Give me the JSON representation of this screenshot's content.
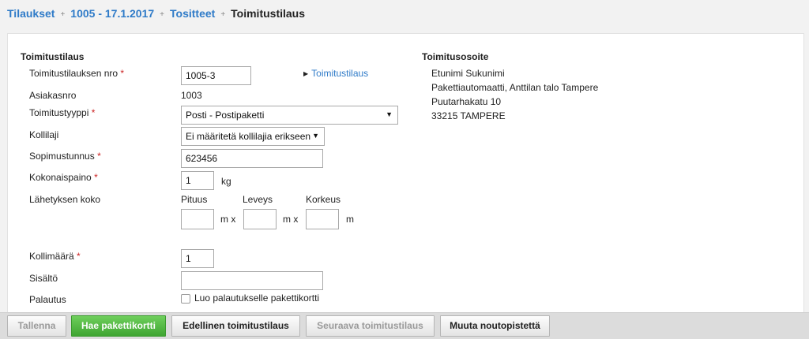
{
  "breadcrumb": {
    "items": [
      "Tilaukset",
      "1005 - 17.1.2017",
      "Tositteet"
    ],
    "current": "Toimitustilaus",
    "separator": "+"
  },
  "form": {
    "section_title": "Toimitustilaus",
    "order_no_label": "Toimitustilauksen nro",
    "order_no_value": "1005-3",
    "order_link": "Toimitustilaus",
    "customer_no_label": "Asiakasnro",
    "customer_no_value": "1003",
    "delivery_type_label": "Toimitustyyppi",
    "delivery_type_value": "Posti - Postipaketti",
    "package_type_label": "Kollilaji",
    "package_type_value": "Ei määritetä kollilajia erikseen",
    "contract_no_label": "Sopimustunnus",
    "contract_no_value": "623456",
    "total_weight_label": "Kokonaispaino",
    "total_weight_value": "1",
    "weight_unit": "kg",
    "size_label": "Lähetyksen koko",
    "length_label": "Pituus",
    "width_label": "Leveys",
    "height_label": "Korkeus",
    "length_value": "",
    "width_value": "",
    "height_value": "",
    "mx_1": "m x",
    "mx_2": "m x",
    "m_unit": "m",
    "package_count_label": "Kollimäärä",
    "package_count_value": "1",
    "contents_label": "Sisältö",
    "contents_value": "",
    "return_label": "Palautus",
    "return_checkbox_label": "Luo palautukselle pakettikortti",
    "required_mark": "*"
  },
  "address": {
    "title": "Toimitusosoite",
    "lines": [
      "Etunimi Sukunimi",
      "Pakettiautomaatti, Anttilan talo Tampere",
      "Puutarhakatu 10",
      "33215 TAMPERE"
    ]
  },
  "toolbar": {
    "save": "Tallenna",
    "get_card": "Hae pakettikortti",
    "previous": "Edellinen toimitustilaus",
    "next": "Seuraava toimitustilaus",
    "change_pickup": "Muuta noutopistettä"
  },
  "colors": {
    "link": "#2f7bc8",
    "primary_button": "#4cb33e",
    "required": "#cc2222"
  }
}
